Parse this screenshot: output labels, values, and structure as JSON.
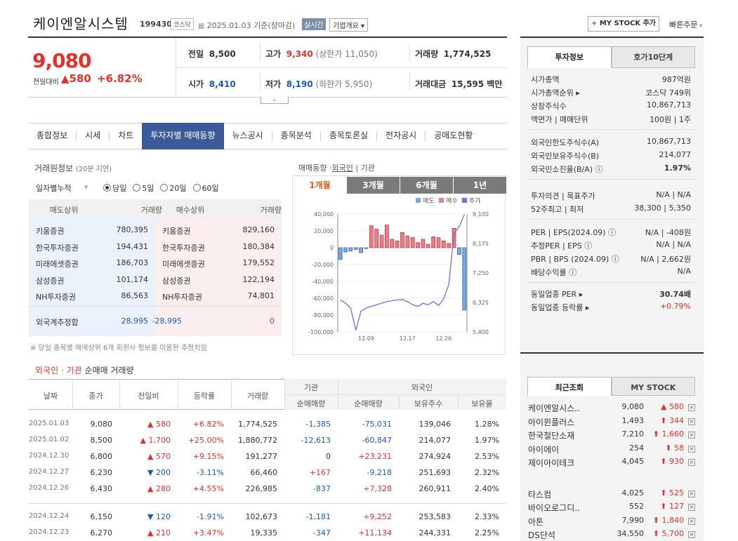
{
  "header": {
    "name": "케이엔알시스템",
    "code": "199430",
    "market_tag": "코스닥",
    "date": "2025.01.03",
    "date_suffix": "기준(장마감)",
    "realtime": "실시간",
    "company": "기업개요 ▾",
    "mystock": "MY STOCK 추가",
    "quick_order": "빠른주문"
  },
  "quote": {
    "price": "9,080",
    "change_label": "전일대비",
    "change": "▲580",
    "change_pct": "+6.82%",
    "prev_label": "전일",
    "prev": "8,500",
    "high_label": "고가",
    "high": "9,340",
    "upper": "(상한가 11,050)",
    "volume_label": "거래량",
    "volume": "1,774,525",
    "open_label": "시가",
    "open": "8,410",
    "low_label": "저가",
    "low": "8,190",
    "lower": "(하한가 5,950)",
    "amount_label": "거래대금",
    "amount": "15,595 백만"
  },
  "tabs": [
    "종합정보",
    "시세",
    "차트",
    "투자자별 매매동향",
    "뉴스공시",
    "종목분석",
    "종목토론실",
    "전자공시",
    "공매도현황"
  ],
  "trade_info": {
    "title": "거래원정보",
    "delay": "(20분 지연)",
    "period_label": "일자별누적",
    "options": [
      "당일",
      "5일",
      "20일",
      "60일"
    ],
    "selected": "당일",
    "headers": [
      "매도상위",
      "거래량",
      "매수상위",
      "거래량"
    ],
    "sell": [
      [
        "키움증권",
        "780,395"
      ],
      [
        "한국투자증권",
        "194,431"
      ],
      [
        "미래에셋증권",
        "186,703"
      ],
      [
        "삼성증권",
        "101,174"
      ],
      [
        "NH투자증권",
        "86,563"
      ]
    ],
    "buy": [
      [
        "키움증권",
        "829,160"
      ],
      [
        "한국투자증권",
        "180,384"
      ],
      [
        "미래에셋증권",
        "179,552"
      ],
      [
        "삼성증권",
        "122,194"
      ],
      [
        "NH투자증권",
        "74,801"
      ]
    ],
    "foreign_label": "외국계추정합",
    "foreign_sell": "28,995",
    "foreign_buy": "-28,995",
    "foreign_net": "0",
    "note": "※ 당일 종목별 매매상위 6개 회원사 정보를 이용한 추정치임"
  },
  "trend": {
    "title": "매매동향",
    "foreign": "외국인",
    "inst": "기관",
    "periods": [
      "1개월",
      "3개월",
      "6개월",
      "1년"
    ],
    "selected": "1개월"
  },
  "chart_data": {
    "type": "bar",
    "title": "",
    "legend": [
      "매도",
      "매수",
      "주가"
    ],
    "x_ticks": [
      "12.09",
      "12.17",
      "12.26"
    ],
    "y_left_ticks": [
      "40,000",
      "20,000",
      "0",
      "-20,000",
      "-40,000",
      "-60,000",
      "-80,000",
      "-100,000"
    ],
    "ylim_left": [
      -100000,
      40000
    ],
    "y_right_ticks": [
      "9,100",
      "8,175",
      "7,250",
      "6,325",
      "5,400"
    ],
    "ylim_right": [
      5400,
      9100
    ],
    "series": [
      {
        "name": "매수",
        "values": [
          -14000,
          -5000,
          -4000,
          -2000,
          -6000,
          -1000,
          26000,
          22000,
          15000,
          27000,
          10000,
          8000,
          18000,
          14000,
          12000,
          6000,
          10000,
          4000,
          13000,
          12000,
          8000,
          5000,
          23000,
          -8000,
          -74000
        ]
      },
      {
        "name": "주가",
        "values": [
          6400,
          6300,
          6150,
          5450,
          6050,
          6150,
          6200,
          6250,
          6300,
          6350,
          6380,
          6400,
          6420,
          6350,
          6250,
          6200,
          6300,
          6250,
          6350,
          6230,
          6430,
          6900,
          8500,
          8700,
          9080
        ]
      }
    ]
  },
  "table": {
    "title_a": "외국인",
    "title_dot": "·",
    "title_b": "기관",
    "title_c": "순매매 거래량",
    "h1": [
      "날짜",
      "종가",
      "전일비",
      "등락률",
      "거래량",
      "기관",
      "외국인"
    ],
    "h2": [
      "순매매량",
      "순매매량",
      "보유주수",
      "보유율"
    ],
    "rows": [
      [
        "2025.01.03",
        "9,080",
        "▲ 580",
        "+6.82%",
        "1,774,525",
        "-1,385",
        "-75,031",
        "139,046",
        "1.28%"
      ],
      [
        "2025.01.02",
        "8,500",
        "▲ 1,700",
        "+25.00%",
        "1,880,772",
        "-12,613",
        "-60,847",
        "214,077",
        "1.97%"
      ],
      [
        "2024.12.30",
        "6,800",
        "▲ 570",
        "+9.15%",
        "191,277",
        "0",
        "+23,231",
        "274,924",
        "2.53%"
      ],
      [
        "2024.12.27",
        "6,230",
        "▼ 200",
        "-3.11%",
        "66,460",
        "+167",
        "-9,218",
        "251,693",
        "2.32%"
      ],
      [
        "2024.12.26",
        "6,430",
        "▲ 280",
        "+4.55%",
        "226,985",
        "-837",
        "+7,328",
        "260,911",
        "2.40%"
      ],
      [
        "2024.12.24",
        "6,150",
        "▼ 120",
        "-1.91%",
        "102,673",
        "-1,181",
        "+9,252",
        "253,583",
        "2.33%"
      ],
      [
        "2024.12.23",
        "6,270",
        "▲ 210",
        "+3.47%",
        "19,335",
        "-347",
        "+11,134",
        "244,331",
        "2.25%"
      ]
    ]
  },
  "right": {
    "tabs": [
      "투자정보",
      "호가10단계"
    ],
    "g1": [
      [
        "시가총액",
        "987억원"
      ],
      [
        "시가총액순위 ▸",
        "코스닥 749위"
      ],
      [
        "상장주식수",
        "10,867,713"
      ],
      [
        "액면가 | 매매단위",
        "100원 | 1주"
      ]
    ],
    "g2": [
      [
        "외국인한도주식수(A)",
        "10,867,713"
      ],
      [
        "외국인보유주식수(B)",
        "214,077"
      ],
      [
        "외국인소진율(B/A) ⓘ",
        "1.97%"
      ]
    ],
    "g3": [
      [
        "투자의견 | 목표주가",
        "N/A | N/A"
      ],
      [
        "52주최고 | 최저",
        "38,300 | 5,350"
      ]
    ],
    "g4": [
      [
        "PER | EPS(2024.09) ⓘ",
        "N/A | -408원"
      ],
      [
        "추정PER | EPS ⓘ",
        "N/A | N/A"
      ],
      [
        "PBR | BPS (2024.09) ⓘ",
        "N/A | 2,662원"
      ],
      [
        "배당수익률 ⓘ",
        "N/A"
      ]
    ],
    "g5": [
      [
        "동일업종 PER ▸",
        "30.74배"
      ],
      [
        "동일업종 등락률 ▸",
        "+0.79%"
      ]
    ],
    "recent_tabs": [
      "최근조회",
      "MY STOCK"
    ],
    "recent": [
      [
        "케이엔알시스..",
        "9,080",
        "▲ 580"
      ],
      [
        "아이윈플러스",
        "1,493",
        "⬆ 344"
      ],
      [
        "한국철단소재",
        "7,210",
        "⬆ 1,660"
      ],
      [
        "아이에이",
        "254",
        "⬆ 58"
      ],
      [
        "제이아이테크",
        "4,045",
        "⬆ 930"
      ]
    ],
    "recent2": [
      [
        "타스컴",
        "4,025",
        "⬆ 525"
      ],
      [
        "바이오로그디..",
        "552",
        "⬆ 127"
      ],
      [
        "아톤",
        "7,990",
        "⬆ 1,840"
      ],
      [
        "DS단석",
        "34,550",
        "⬆ 5,700"
      ]
    ]
  }
}
